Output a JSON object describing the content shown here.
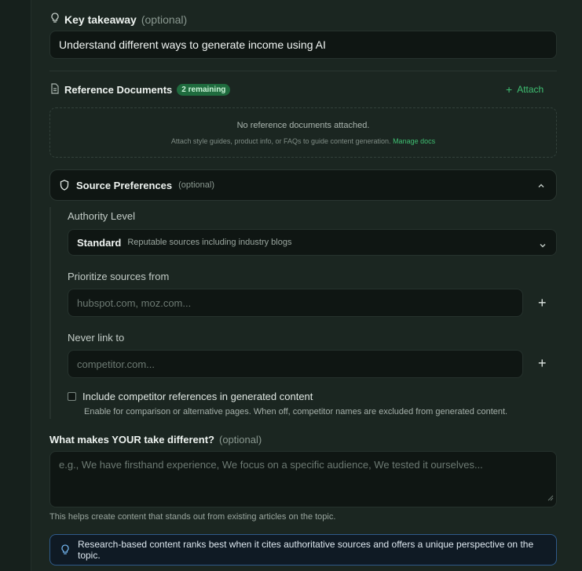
{
  "key_takeaway": {
    "label": "Key takeaway",
    "optional": "(optional)",
    "value": "Understand different ways to generate income using AI"
  },
  "reference_docs": {
    "title": "Reference Documents",
    "badge": "2 remaining",
    "attach_label": "Attach",
    "empty_title": "No reference documents attached.",
    "empty_hint": "Attach style guides, product info, or FAQs to guide content generation.",
    "manage_link": "Manage docs"
  },
  "source_prefs": {
    "title": "Source Preferences",
    "optional": "(optional)",
    "authority": {
      "label": "Authority Level",
      "selected": "Standard",
      "description": "Reputable sources including industry blogs"
    },
    "prioritize": {
      "label": "Prioritize sources from",
      "placeholder": "hubspot.com, moz.com..."
    },
    "never_link": {
      "label": "Never link to",
      "placeholder": "competitor.com..."
    },
    "competitor": {
      "label": "Include competitor references in generated content",
      "checked": false,
      "hint": "Enable for comparison or alternative pages. When off, competitor names are excluded from generated content."
    }
  },
  "unique_take": {
    "label": "What makes YOUR take different?",
    "optional": "(optional)",
    "placeholder": "e.g., We have firsthand experience, We focus on a specific audience, We tested it ourselves...",
    "help": "This helps create content that stands out from existing articles on the topic."
  },
  "tip": {
    "text": "Research-based content ranks best when it cites authoritative sources and offers a unique perspective on the topic."
  },
  "colors": {
    "accent_green": "#3fbf72",
    "tip_border": "#2e5a8a"
  }
}
